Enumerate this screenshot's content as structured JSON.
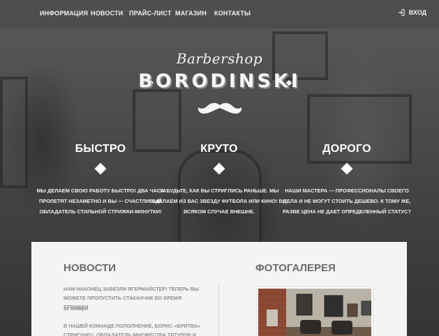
{
  "nav": {
    "items": [
      {
        "label": "ИНФОРМАЦИЯ"
      },
      {
        "label": "НОВОСТИ"
      },
      {
        "label": "ПРАЙС-ЛИСТ"
      },
      {
        "label": "МАГАЗИН"
      },
      {
        "label": "КОНТАКТЫ"
      }
    ],
    "login_label": "ВХОД",
    "login_icon": "login-arrow-icon"
  },
  "brand": {
    "script": "Barbershop",
    "name": "BORODINSKI",
    "logo_icon": "mustache-icon"
  },
  "features": [
    {
      "title": "БЫСТРО",
      "text": "МЫ ДЕЛАЕМ СВОЮ РАБОТУ БЫСТРО! ДВА ЧАСА ПРОЛЕТЯТ НЕЗАМЕТНО И ВЫ — СЧАСТЛИВЫЙ ОБЛАДАТЕЛЬ СТИЛЬНОЙ СТРИЖКИ-МИНУТКИ!"
    },
    {
      "title": "КРУТО",
      "text": "ЗАБУДЬТЕ, КАК ВЫ СТРИГЛИСЬ РАНЬШЕ. МЫ СДЕЛАЕМ ИЗ ВАС ЗВЕЗДУ ФУТБОЛА ИЛИ КИНО! ВО ВСЯКОМ СЛУЧАЕ ВНЕШНЕ."
    },
    {
      "title": "ДОРОГО",
      "text": "НАШИ МАСТЕРА — ПРОФЕССИОНАЛЫ СВОЕГО ДЕЛА И НЕ МОГУТ СТОИТЬ ДЕШЕВО. К ТОМУ ЖЕ, РАЗВЕ ЦЕНА НЕ ДАЕТ ОПРЕДЕЛЕННЫЙ СТАТУС?"
    }
  ],
  "news": {
    "heading": "НОВОСТИ",
    "items": [
      {
        "text": "НАМ НАКОНЕЦ ЗАВЕЗЛИ ЯГЕРМАЙСТЕР! ТЕПЕРЬ ВЫ МОЖЕТЕ ПРОПУСТИТЬ СТАКАНЧИК ВО ВРЕМЯ СТРИЖКИ",
        "date": "11 января"
      },
      {
        "text": "В НАШЕЙ КОМАНДЕ ПОПОЛНЕНИЕ, БОРИС «БРИТВА» СТРИГУНЕЦ, ОБЛАДАТЕЛЬ МНОЖЕСТВА ТИТУЛОВ И НАГРАД В ОБЛАСТИ УСОВ"
      }
    ]
  },
  "gallery": {
    "heading": "ФОТОГАЛЕРЕЯ"
  },
  "colors": {
    "panel_bg": "#f4f4f4",
    "heading_gray": "#6b6b6b",
    "text_gray": "#8e8e8e"
  }
}
